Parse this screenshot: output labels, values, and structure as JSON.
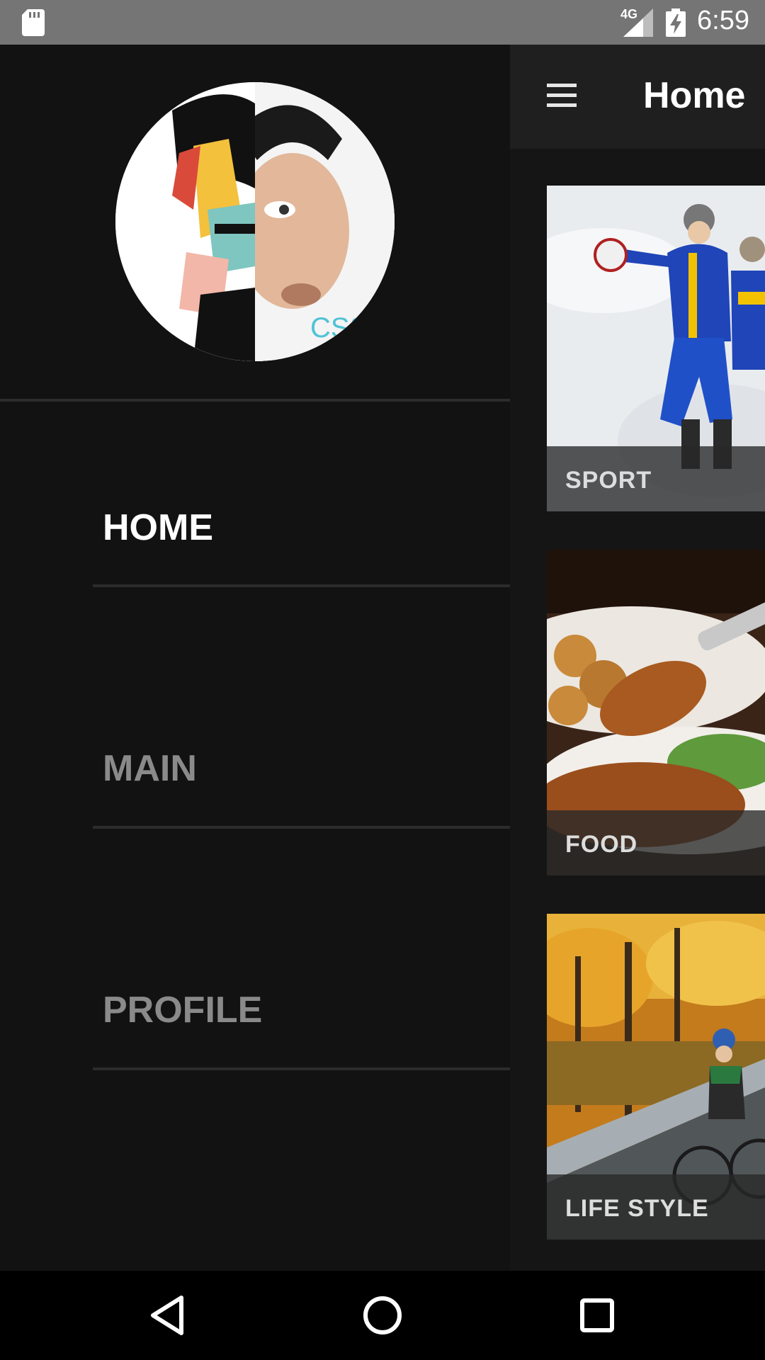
{
  "status_bar": {
    "time": "6:59",
    "network": "4G",
    "icons": [
      "sd-card-icon",
      "signal-icon",
      "battery-charging-icon"
    ]
  },
  "toolbar": {
    "title": "Home",
    "menu_icon": "hamburger-menu-icon"
  },
  "drawer": {
    "items": [
      {
        "label": "HOME",
        "active": true
      },
      {
        "label": "MAIN",
        "active": false
      },
      {
        "label": "PROFILE",
        "active": false
      }
    ]
  },
  "cards": [
    {
      "label": "SPORT"
    },
    {
      "label": "FOOD"
    },
    {
      "label": "LIFE STYLE"
    }
  ],
  "colors": {
    "status_bar_bg": "#757575",
    "drawer_bg": "#121212",
    "toolbar_bg": "#1f1f1f",
    "nav_active": "#ffffff",
    "nav_inactive": "#8a8a8a"
  },
  "nav_bar": {
    "icons": [
      "back-icon",
      "home-circle-icon",
      "recents-square-icon"
    ]
  }
}
